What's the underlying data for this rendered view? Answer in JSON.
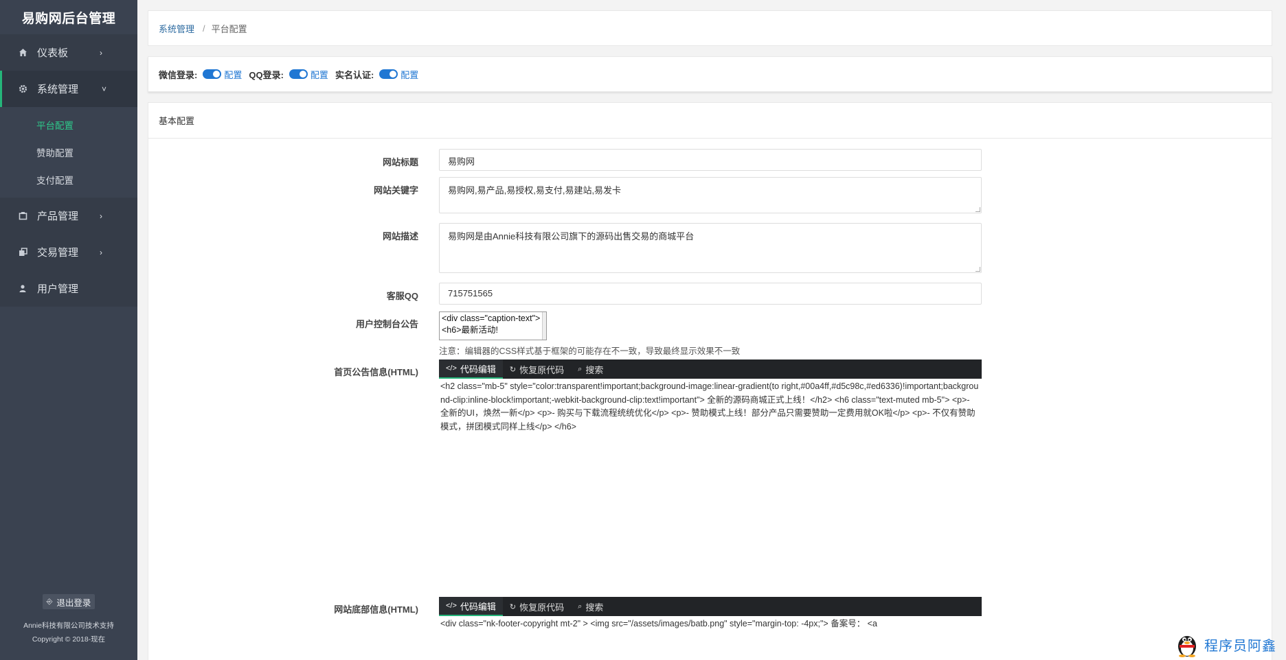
{
  "sidebar": {
    "brand": "易购网后台管理",
    "items": [
      {
        "label": "仪表板",
        "icon": "home-icon"
      },
      {
        "label": "系统管理",
        "icon": "gear-icon"
      },
      {
        "label": "产品管理",
        "icon": "box-icon"
      },
      {
        "label": "交易管理",
        "icon": "copy-icon"
      },
      {
        "label": "用户管理",
        "icon": "user-icon"
      }
    ],
    "sub_items": [
      "平台配置",
      "赞助配置",
      "支付配置"
    ],
    "logout": "退出登录",
    "support": "Annie科技有限公司技术支持",
    "copyright": "Copyright © 2018-现在"
  },
  "breadcrumb": {
    "parent": "系统管理",
    "current": "平台配置"
  },
  "toggles": [
    {
      "label": "微信登录:",
      "link": "配置",
      "on": true
    },
    {
      "label": "QQ登录:",
      "link": "配置",
      "on": true
    },
    {
      "label": "实名认证:",
      "link": "配置",
      "on": true
    }
  ],
  "panel": {
    "title": "基本配置",
    "site_title": {
      "label": "网站标题",
      "value": "易购网"
    },
    "keywords": {
      "label": "网站关键字",
      "value": "易购网,易产品,易授权,易支付,易建站,易发卡"
    },
    "description": {
      "label": "网站描述",
      "value": "易购网是由Annie科技有限公司旗下的源码出售交易的商城平台"
    },
    "qq": {
      "label": "客服QQ",
      "value": "715751565"
    },
    "notice": {
      "label": "用户控制台公告",
      "value": "<div class=\"caption-text\"><h6>最新活动!",
      "hint": "注意：编辑器的CSS样式基于框架的可能存在不一致，导致最终显示效果不一致"
    },
    "home_notice": {
      "label": "首页公告信息(HTML)",
      "code": "<h2 class=\"mb-5\" style=\"color:transparent!important;background-image:linear-gradient(to right,#00a4ff,#d5c98c,#ed6336)!important;background-clip:inline-block!important;-webkit-background-clip:text!important\"> 全新的源码商城正式上线！</h2> <h6 class=\"text-muted mb-5\"> <p>- 全新的UI，焕然一新</p> <p>- 购买与下载流程统统优化</p> <p>- 赞助模式上线！部分产品只需要赞助一定费用就OK啦</p> <p>- 不仅有赞助模式，拼团模式同样上线</p> </h6>"
    },
    "footer": {
      "label": "网站底部信息(HTML)",
      "code": "<div class=\"nk-footer-copyright mt-2\" > <img src=\"/assets/images/batb.png\" style=\"margin-top: -4px;\"> 备案号： <a"
    },
    "editor": {
      "tab_edit": "代码编辑",
      "tab_restore": "恢复原代码",
      "tab_search": "搜索"
    }
  },
  "watermark": "程序员阿鑫"
}
